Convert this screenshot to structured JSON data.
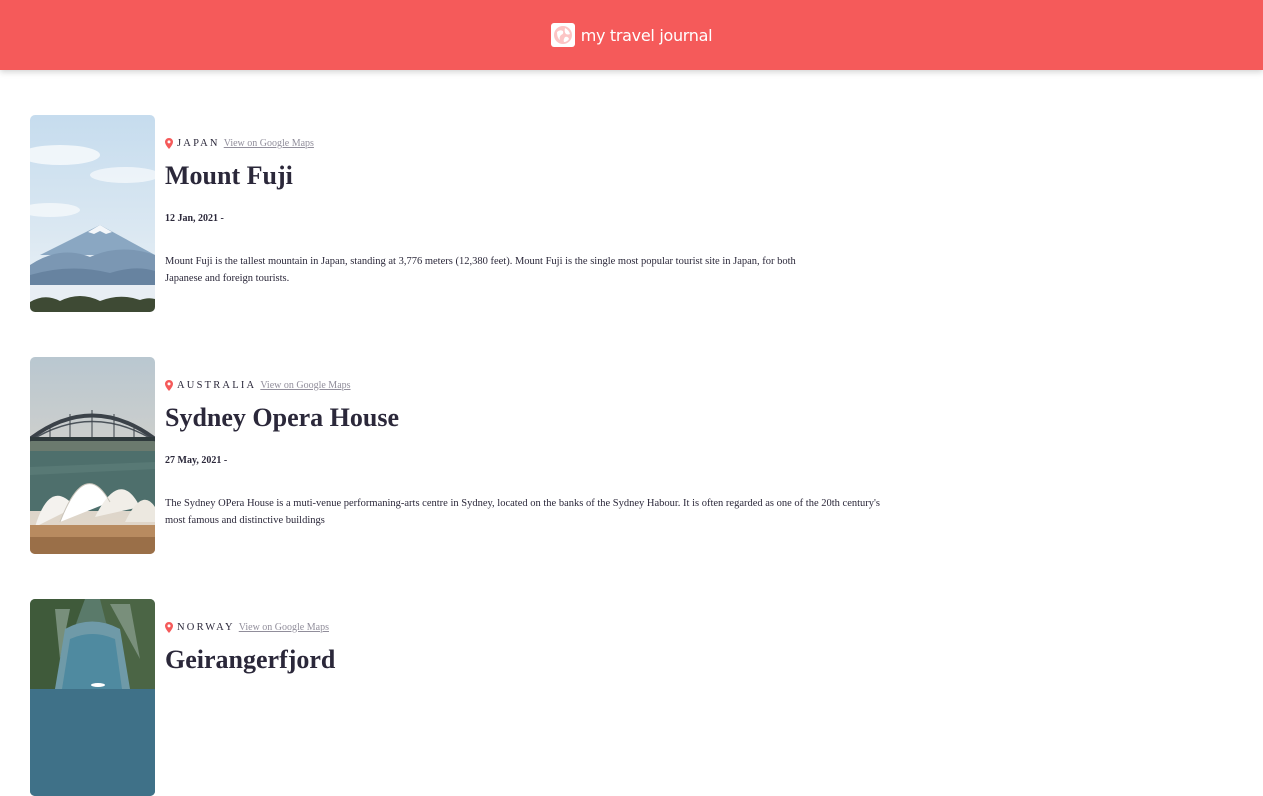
{
  "header": {
    "title": "my travel journal",
    "icon": "globe-icon",
    "background_color": "#f55a5a"
  },
  "entries": [
    {
      "location": "JAPAN",
      "maps_link_label": "View on Google Maps",
      "title": "Mount Fuji",
      "dates": "12 Jan, 2021 -",
      "description": "Mount Fuji is the tallest mountain in Japan, standing at 3,776 meters (12,380 feet). Mount Fuji is the single most popular tourist site in Japan, for both Japanese and foreign tourists.",
      "icon": "location-pin-icon"
    },
    {
      "location": "AUSTRALIA",
      "maps_link_label": "View on Google Maps",
      "title": "Sydney Opera House",
      "dates": "27 May, 2021 -",
      "description": "The Sydney OPera House is a muti-venue performaning-arts centre in Sydney, located on the banks of the Sydney Habour. It is often regarded as one of the 20th century's most famous and distinctive buildings",
      "icon": "location-pin-icon"
    },
    {
      "location": "NORWAY",
      "maps_link_label": "View on Google Maps",
      "title": "Geirangerfjord",
      "icon": "location-pin-icon"
    }
  ],
  "colors": {
    "accent": "#f55a5a",
    "text": "#2b283a",
    "link": "#918e9b"
  }
}
